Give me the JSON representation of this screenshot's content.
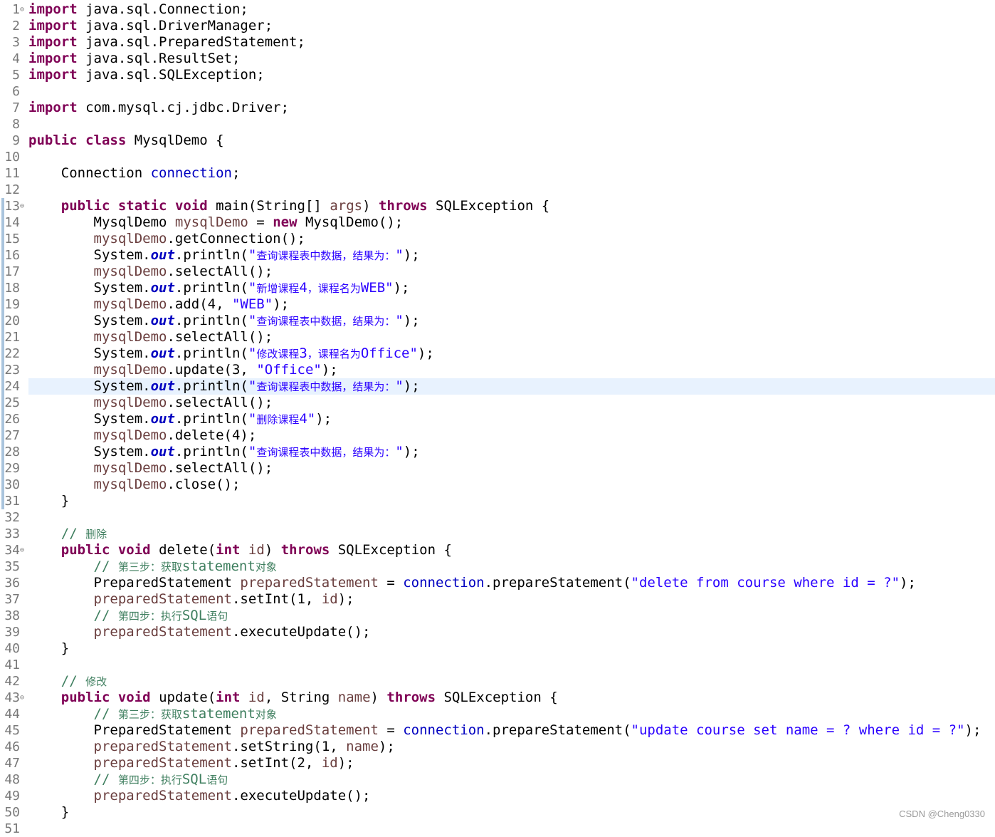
{
  "editor": {
    "current_line": 24,
    "lines": [
      {
        "n": "1",
        "fold": "⊖",
        "tokens": [
          {
            "t": "import",
            "c": "kw"
          },
          {
            "t": " java.sql.Connection;"
          }
        ]
      },
      {
        "n": "2",
        "tokens": [
          {
            "t": "import",
            "c": "kw"
          },
          {
            "t": " java.sql.DriverManager;"
          }
        ]
      },
      {
        "n": "3",
        "tokens": [
          {
            "t": "import",
            "c": "kw"
          },
          {
            "t": " java.sql.PreparedStatement;"
          }
        ]
      },
      {
        "n": "4",
        "tokens": [
          {
            "t": "import",
            "c": "kw"
          },
          {
            "t": " java.sql.ResultSet;"
          }
        ]
      },
      {
        "n": "5",
        "tokens": [
          {
            "t": "import",
            "c": "kw"
          },
          {
            "t": " java.sql.SQLException;"
          }
        ]
      },
      {
        "n": "6",
        "tokens": []
      },
      {
        "n": "7",
        "tokens": [
          {
            "t": "import",
            "c": "kw"
          },
          {
            "t": " com.mysql.cj.jdbc.Driver;"
          }
        ]
      },
      {
        "n": "8",
        "tokens": []
      },
      {
        "n": "9",
        "tokens": [
          {
            "t": "public",
            "c": "kw"
          },
          {
            "t": " "
          },
          {
            "t": "class",
            "c": "kw"
          },
          {
            "t": " MysqlDemo {"
          }
        ]
      },
      {
        "n": "10",
        "tokens": []
      },
      {
        "n": "11",
        "tokens": [
          {
            "t": "    Connection "
          },
          {
            "t": "connection",
            "c": "fld"
          },
          {
            "t": ";"
          }
        ]
      },
      {
        "n": "12",
        "tokens": []
      },
      {
        "n": "13",
        "fold": "⊖",
        "tokens": [
          {
            "t": "    "
          },
          {
            "t": "public",
            "c": "kw"
          },
          {
            "t": " "
          },
          {
            "t": "static",
            "c": "kw"
          },
          {
            "t": " "
          },
          {
            "t": "void",
            "c": "kw"
          },
          {
            "t": " main(String[] "
          },
          {
            "t": "args",
            "c": "var"
          },
          {
            "t": ") "
          },
          {
            "t": "throws",
            "c": "kw"
          },
          {
            "t": " SQLException {"
          }
        ]
      },
      {
        "n": "14",
        "tokens": [
          {
            "t": "        MysqlDemo "
          },
          {
            "t": "mysqlDemo",
            "c": "var"
          },
          {
            "t": " = "
          },
          {
            "t": "new",
            "c": "kw"
          },
          {
            "t": " MysqlDemo();"
          }
        ]
      },
      {
        "n": "15",
        "tokens": [
          {
            "t": "        "
          },
          {
            "t": "mysqlDemo",
            "c": "var"
          },
          {
            "t": ".getConnection();"
          }
        ]
      },
      {
        "n": "16",
        "tokens": [
          {
            "t": "        System."
          },
          {
            "t": "out",
            "c": "sfld"
          },
          {
            "t": ".println("
          },
          {
            "t": "\"",
            "c": "str"
          },
          {
            "t": "查询课程表中数据，结果为：",
            "c": "str cjk"
          },
          {
            "t": "\"",
            "c": "str"
          },
          {
            "t": ");"
          }
        ]
      },
      {
        "n": "17",
        "tokens": [
          {
            "t": "        "
          },
          {
            "t": "mysqlDemo",
            "c": "var"
          },
          {
            "t": ".selectAll();"
          }
        ]
      },
      {
        "n": "18",
        "tokens": [
          {
            "t": "        System."
          },
          {
            "t": "out",
            "c": "sfld"
          },
          {
            "t": ".println("
          },
          {
            "t": "\"",
            "c": "str"
          },
          {
            "t": "新增课程",
            "c": "str cjk"
          },
          {
            "t": "4",
            "c": "str"
          },
          {
            "t": "，课程名为",
            "c": "str cjk"
          },
          {
            "t": "WEB\"",
            "c": "str"
          },
          {
            "t": ");"
          }
        ]
      },
      {
        "n": "19",
        "tokens": [
          {
            "t": "        "
          },
          {
            "t": "mysqlDemo",
            "c": "var"
          },
          {
            "t": ".add(4, "
          },
          {
            "t": "\"WEB\"",
            "c": "str"
          },
          {
            "t": ");"
          }
        ]
      },
      {
        "n": "20",
        "tokens": [
          {
            "t": "        System."
          },
          {
            "t": "out",
            "c": "sfld"
          },
          {
            "t": ".println("
          },
          {
            "t": "\"",
            "c": "str"
          },
          {
            "t": "查询课程表中数据，结果为：",
            "c": "str cjk"
          },
          {
            "t": "\"",
            "c": "str"
          },
          {
            "t": ");"
          }
        ]
      },
      {
        "n": "21",
        "tokens": [
          {
            "t": "        "
          },
          {
            "t": "mysqlDemo",
            "c": "var"
          },
          {
            "t": ".selectAll();"
          }
        ]
      },
      {
        "n": "22",
        "tokens": [
          {
            "t": "        System."
          },
          {
            "t": "out",
            "c": "sfld"
          },
          {
            "t": ".println("
          },
          {
            "t": "\"",
            "c": "str"
          },
          {
            "t": "修改课程",
            "c": "str cjk"
          },
          {
            "t": "3",
            "c": "str"
          },
          {
            "t": "，课程名为",
            "c": "str cjk"
          },
          {
            "t": "Office\"",
            "c": "str"
          },
          {
            "t": ");"
          }
        ]
      },
      {
        "n": "23",
        "tokens": [
          {
            "t": "        "
          },
          {
            "t": "mysqlDemo",
            "c": "var"
          },
          {
            "t": ".update(3, "
          },
          {
            "t": "\"Office\"",
            "c": "str"
          },
          {
            "t": ");"
          }
        ]
      },
      {
        "n": "24",
        "tokens": [
          {
            "t": "        System."
          },
          {
            "t": "out",
            "c": "sfld"
          },
          {
            "t": ".println("
          },
          {
            "t": "\"",
            "c": "str"
          },
          {
            "t": "查询课程表中数据，结果为：",
            "c": "str cjk"
          },
          {
            "t": "\"",
            "c": "str"
          },
          {
            "t": ");"
          }
        ]
      },
      {
        "n": "25",
        "tokens": [
          {
            "t": "        "
          },
          {
            "t": "mysqlDemo",
            "c": "var"
          },
          {
            "t": ".selectAll();"
          }
        ]
      },
      {
        "n": "26",
        "tokens": [
          {
            "t": "        System."
          },
          {
            "t": "out",
            "c": "sfld"
          },
          {
            "t": ".println("
          },
          {
            "t": "\"",
            "c": "str"
          },
          {
            "t": "删除课程",
            "c": "str cjk"
          },
          {
            "t": "4\"",
            "c": "str"
          },
          {
            "t": ");"
          }
        ]
      },
      {
        "n": "27",
        "tokens": [
          {
            "t": "        "
          },
          {
            "t": "mysqlDemo",
            "c": "var"
          },
          {
            "t": ".delete(4);"
          }
        ]
      },
      {
        "n": "28",
        "tokens": [
          {
            "t": "        System."
          },
          {
            "t": "out",
            "c": "sfld"
          },
          {
            "t": ".println("
          },
          {
            "t": "\"",
            "c": "str"
          },
          {
            "t": "查询课程表中数据，结果为：",
            "c": "str cjk"
          },
          {
            "t": "\"",
            "c": "str"
          },
          {
            "t": ");"
          }
        ]
      },
      {
        "n": "29",
        "tokens": [
          {
            "t": "        "
          },
          {
            "t": "mysqlDemo",
            "c": "var"
          },
          {
            "t": ".selectAll();"
          }
        ]
      },
      {
        "n": "30",
        "tokens": [
          {
            "t": "        "
          },
          {
            "t": "mysqlDemo",
            "c": "var"
          },
          {
            "t": ".close();"
          }
        ]
      },
      {
        "n": "31",
        "tokens": [
          {
            "t": "    }"
          }
        ]
      },
      {
        "n": "32",
        "tokens": []
      },
      {
        "n": "33",
        "tokens": [
          {
            "t": "    "
          },
          {
            "t": "// ",
            "c": "cmt"
          },
          {
            "t": "删除",
            "c": "cmt cjk"
          }
        ]
      },
      {
        "n": "34",
        "fold": "⊖",
        "tokens": [
          {
            "t": "    "
          },
          {
            "t": "public",
            "c": "kw"
          },
          {
            "t": " "
          },
          {
            "t": "void",
            "c": "kw"
          },
          {
            "t": " delete("
          },
          {
            "t": "int",
            "c": "kw"
          },
          {
            "t": " "
          },
          {
            "t": "id",
            "c": "var"
          },
          {
            "t": ") "
          },
          {
            "t": "throws",
            "c": "kw"
          },
          {
            "t": " SQLException {"
          }
        ]
      },
      {
        "n": "35",
        "tokens": [
          {
            "t": "        "
          },
          {
            "t": "// ",
            "c": "cmt"
          },
          {
            "t": "第三步：获取",
            "c": "cmt cjk"
          },
          {
            "t": "statement",
            "c": "cmt"
          },
          {
            "t": "对象",
            "c": "cmt cjk"
          }
        ]
      },
      {
        "n": "36",
        "tokens": [
          {
            "t": "        PreparedStatement "
          },
          {
            "t": "preparedStatement",
            "c": "var"
          },
          {
            "t": " = "
          },
          {
            "t": "connection",
            "c": "fld"
          },
          {
            "t": ".prepareStatement("
          },
          {
            "t": "\"delete from course where id = ?\"",
            "c": "str"
          },
          {
            "t": ");"
          }
        ]
      },
      {
        "n": "37",
        "tokens": [
          {
            "t": "        "
          },
          {
            "t": "preparedStatement",
            "c": "var"
          },
          {
            "t": ".setInt(1, "
          },
          {
            "t": "id",
            "c": "var"
          },
          {
            "t": ");"
          }
        ]
      },
      {
        "n": "38",
        "tokens": [
          {
            "t": "        "
          },
          {
            "t": "// ",
            "c": "cmt"
          },
          {
            "t": "第四步：执行",
            "c": "cmt cjk"
          },
          {
            "t": "SQL",
            "c": "cmt"
          },
          {
            "t": "语句",
            "c": "cmt cjk"
          }
        ]
      },
      {
        "n": "39",
        "tokens": [
          {
            "t": "        "
          },
          {
            "t": "preparedStatement",
            "c": "var"
          },
          {
            "t": ".executeUpdate();"
          }
        ]
      },
      {
        "n": "40",
        "tokens": [
          {
            "t": "    }"
          }
        ]
      },
      {
        "n": "41",
        "tokens": []
      },
      {
        "n": "42",
        "tokens": [
          {
            "t": "    "
          },
          {
            "t": "// ",
            "c": "cmt"
          },
          {
            "t": "修改",
            "c": "cmt cjk"
          }
        ]
      },
      {
        "n": "43",
        "fold": "⊖",
        "tokens": [
          {
            "t": "    "
          },
          {
            "t": "public",
            "c": "kw"
          },
          {
            "t": " "
          },
          {
            "t": "void",
            "c": "kw"
          },
          {
            "t": " update("
          },
          {
            "t": "int",
            "c": "kw"
          },
          {
            "t": " "
          },
          {
            "t": "id",
            "c": "var"
          },
          {
            "t": ", String "
          },
          {
            "t": "name",
            "c": "var"
          },
          {
            "t": ") "
          },
          {
            "t": "throws",
            "c": "kw"
          },
          {
            "t": " SQLException {"
          }
        ]
      },
      {
        "n": "44",
        "tokens": [
          {
            "t": "        "
          },
          {
            "t": "// ",
            "c": "cmt"
          },
          {
            "t": "第三步：获取",
            "c": "cmt cjk"
          },
          {
            "t": "statement",
            "c": "cmt"
          },
          {
            "t": "对象",
            "c": "cmt cjk"
          }
        ]
      },
      {
        "n": "45",
        "tokens": [
          {
            "t": "        PreparedStatement "
          },
          {
            "t": "preparedStatement",
            "c": "var"
          },
          {
            "t": " = "
          },
          {
            "t": "connection",
            "c": "fld"
          },
          {
            "t": ".prepareStatement("
          },
          {
            "t": "\"update course set name = ? where id = ?\"",
            "c": "str"
          },
          {
            "t": ");"
          }
        ]
      },
      {
        "n": "46",
        "tokens": [
          {
            "t": "        "
          },
          {
            "t": "preparedStatement",
            "c": "var"
          },
          {
            "t": ".setString(1, "
          },
          {
            "t": "name",
            "c": "var"
          },
          {
            "t": ");"
          }
        ]
      },
      {
        "n": "47",
        "tokens": [
          {
            "t": "        "
          },
          {
            "t": "preparedStatement",
            "c": "var"
          },
          {
            "t": ".setInt(2, "
          },
          {
            "t": "id",
            "c": "var"
          },
          {
            "t": ");"
          }
        ]
      },
      {
        "n": "48",
        "tokens": [
          {
            "t": "        "
          },
          {
            "t": "// ",
            "c": "cmt"
          },
          {
            "t": "第四步：执行",
            "c": "cmt cjk"
          },
          {
            "t": "SQL",
            "c": "cmt"
          },
          {
            "t": "语句",
            "c": "cmt cjk"
          }
        ]
      },
      {
        "n": "49",
        "tokens": [
          {
            "t": "        "
          },
          {
            "t": "preparedStatement",
            "c": "var"
          },
          {
            "t": ".executeUpdate();"
          }
        ]
      },
      {
        "n": "50",
        "tokens": [
          {
            "t": "    }"
          }
        ]
      },
      {
        "n": "51",
        "tokens": []
      }
    ]
  },
  "watermark": "CSDN @Cheng0330",
  "colors": {
    "keyword": "#7f0055",
    "string": "#2a00ff",
    "field": "#0000c0",
    "local_variable": "#6a3e3e",
    "comment": "#3f7f5f",
    "line_number": "#787878",
    "current_line_highlight": "#e8f2fe",
    "change_bar": "#a9c4dd"
  }
}
